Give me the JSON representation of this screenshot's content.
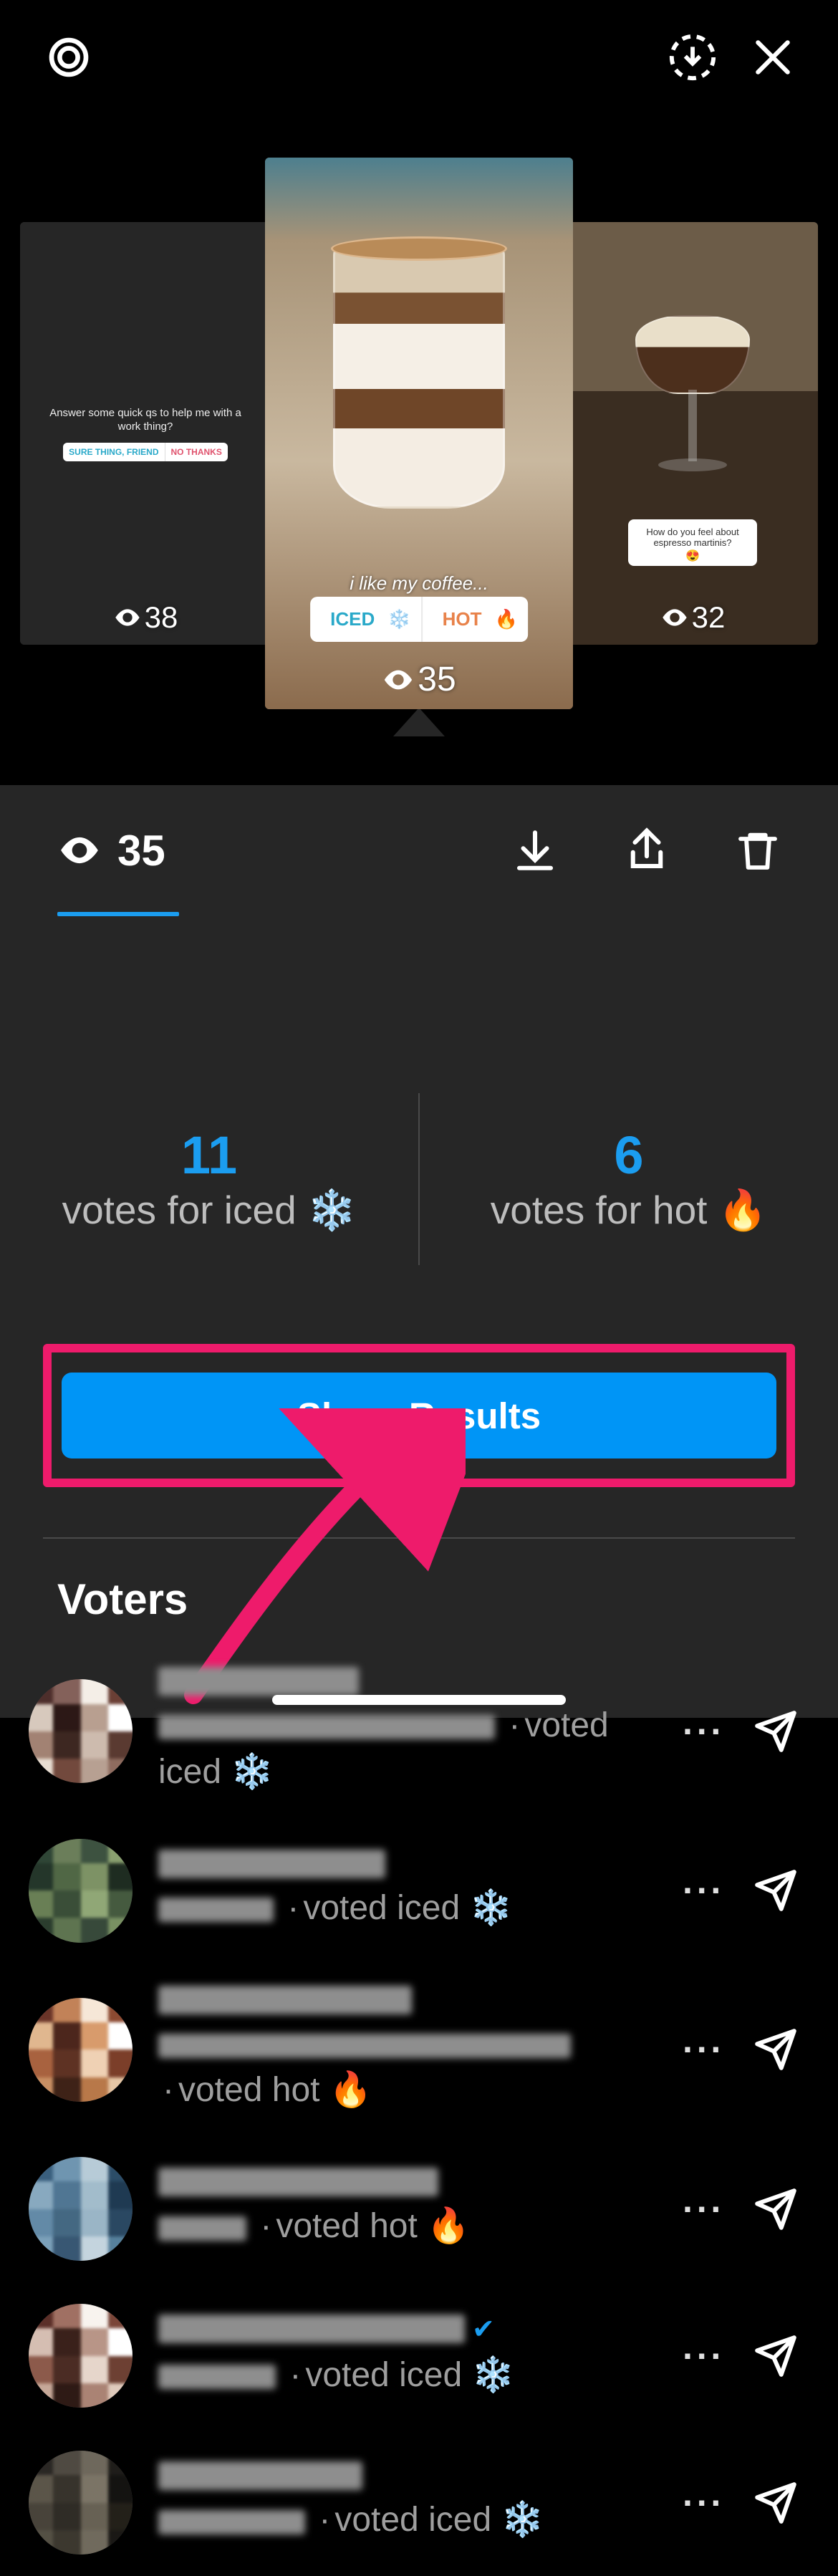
{
  "top": {
    "left_icon": "settings-gear-icon",
    "save_icon": "save-story-icon",
    "close_icon": "close-icon"
  },
  "carousel": {
    "left": {
      "views": "38",
      "question": "Answer some quick qs to help me with a work thing?",
      "optA": "SURE THING, FRIEND",
      "optB": "NO THANKS"
    },
    "center": {
      "views": "35",
      "caption": "i like my coffee...",
      "optA": "ICED",
      "optB": "HOT"
    },
    "right": {
      "views": "32",
      "question": "How do you feel about espresso martinis?"
    }
  },
  "insights": {
    "views": "35"
  },
  "poll": {
    "count_a": "11",
    "label_a": "votes for iced  ❄️",
    "count_b": "6",
    "label_b": "votes for hot  🔥",
    "share_label": "Share Results"
  },
  "voters_title": "Voters",
  "vote_iced": "voted iced  ❄️",
  "vote_hot": "voted hot  🔥",
  "voters": [
    {
      "vote": "iced",
      "verified": false,
      "two_line": true,
      "pal": [
        "#4d2e2b",
        "#84615a",
        "#f4eee7",
        "#6a3f35",
        "#d7c9bd",
        "#2c1816",
        "#b89f90",
        "#fff",
        "#a28273",
        "#3d2721",
        "#cdbbae",
        "#5a3a31",
        "#e8ddd2",
        "#72493d",
        "#b7a092",
        "#8f6c5f"
      ]
    },
    {
      "vote": "iced",
      "verified": false,
      "two_line": false,
      "pal": [
        "#2f4636",
        "#6b7e5a",
        "#3d5240",
        "#8aa06f",
        "#24362a",
        "#506745",
        "#7d9265",
        "#1e2c21",
        "#697f55",
        "#3a4e38",
        "#90a776",
        "#455a3f",
        "#2b3d2e",
        "#5e7450",
        "#37493a",
        "#799062"
      ]
    },
    {
      "vote": "hot",
      "verified": false,
      "two_line": true,
      "pal": [
        "#6a3428",
        "#c28258",
        "#f6e7d7",
        "#8c4a31",
        "#e0b78f",
        "#4c261c",
        "#d89b6c",
        "#fff",
        "#a8623f",
        "#5e3223",
        "#efd1b4",
        "#7b3e29",
        "#c88f63",
        "#3e2217",
        "#b87849",
        "#e6c6a5"
      ]
    },
    {
      "vote": "hot",
      "verified": false,
      "two_line": false,
      "pal": [
        "#3a5f7e",
        "#6f95b0",
        "#b7cbd7",
        "#2c4d68",
        "#88a9bf",
        "#507693",
        "#a2bccb",
        "#1f3a52",
        "#638aa7",
        "#446882",
        "#9ab5c6",
        "#2a4862",
        "#7ba0b9",
        "#385773",
        "#c4d4de",
        "#56809c"
      ]
    },
    {
      "vote": "iced",
      "verified": true,
      "two_line": false,
      "pal": [
        "#5b2f28",
        "#a07063",
        "#f8f3ee",
        "#7a4538",
        "#d5beb2",
        "#3a211b",
        "#b89587",
        "#fff",
        "#8c5a4b",
        "#4b2c24",
        "#e6d6cb",
        "#6d4033",
        "#c6a898",
        "#2e1a15",
        "#aa8374",
        "#dfcabc"
      ]
    },
    {
      "vote": "iced",
      "verified": false,
      "two_line": false,
      "pal": [
        "#2a2724",
        "#4f4a42",
        "#6e685c",
        "#1f1d1a",
        "#5b5549",
        "#37332c",
        "#7b7466",
        "#141311",
        "#48433a",
        "#2f2c26",
        "#676154",
        "#232019",
        "#545044",
        "#3c382f",
        "#706a5d",
        "#1a1815"
      ]
    }
  ]
}
